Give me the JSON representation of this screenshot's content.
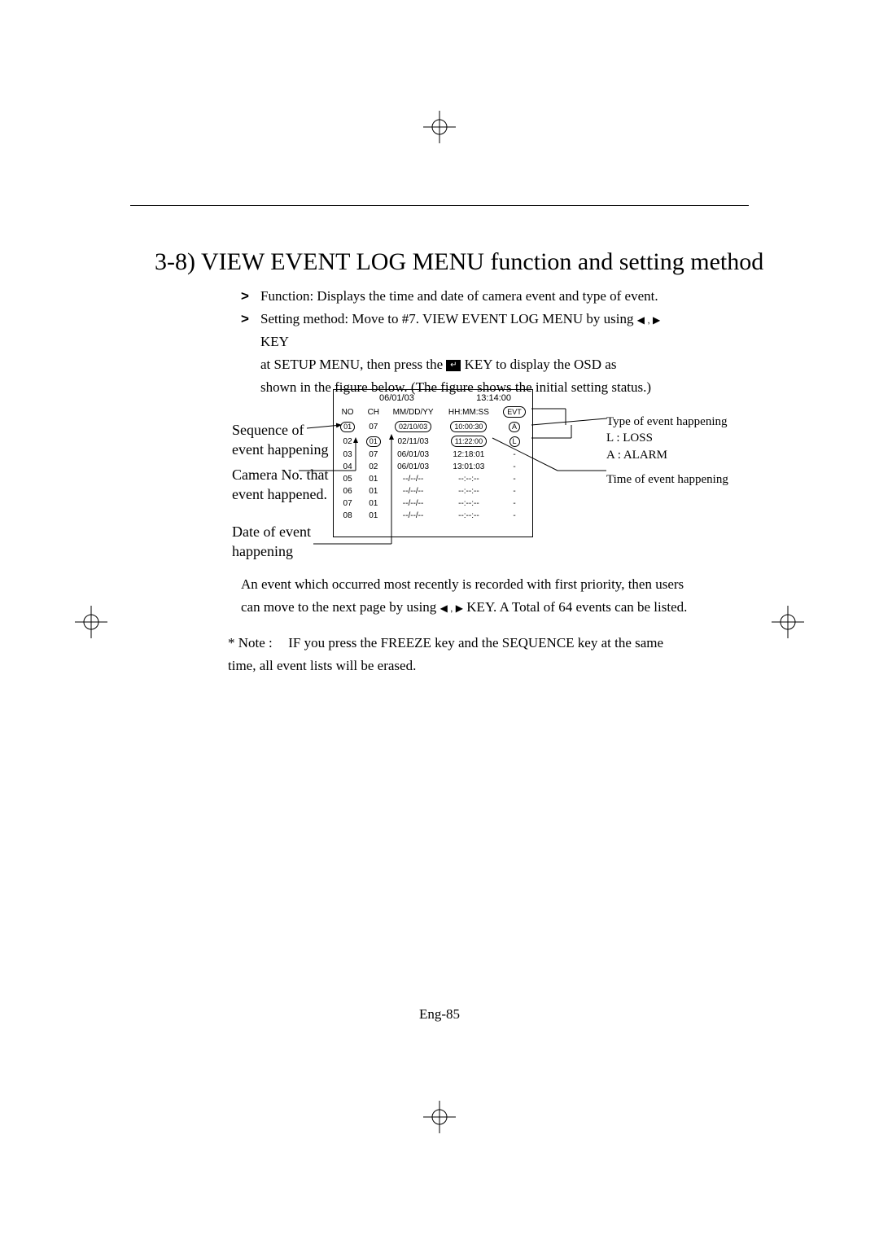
{
  "heading": "3-8)   VIEW EVENT LOG MENU function and setting method",
  "fn_label": "Function:",
  "fn_text": "Displays the time and date of camera event and type of event.",
  "sm_label": "Setting method:",
  "sm_l1a": "Move to #7. VIEW EVENT LOG MENU by using ",
  "sm_l1b": " KEY",
  "sm_l2a": "at SETUP MENU, then press the ",
  "sm_l2b": " KEY to display the OSD as",
  "sm_l3": "shown in the figure below. (The figure shows the initial setting status.)",
  "enter_glyph": "↵",
  "tri_lr": "◀ , ▶",
  "ann_seq": "Sequence of event happening",
  "ann_cam": "Camera No. that event happened.",
  "ann_date": "Date of event happening",
  "ann_type_t": "Type of event happening",
  "ann_type_l": "L : LOSS",
  "ann_type_a": "A : ALARM",
  "ann_time": "Time of event happening",
  "osd": {
    "date": "06/01/03",
    "time": "13:14:00",
    "cols": {
      "no": "NO",
      "ch": "CH",
      "dt": "MM/DD/YY",
      "tm": "HH:MM:SS",
      "ev": "EVT"
    },
    "rows": [
      {
        "no": "01",
        "ch": "07",
        "dt": "02/10/03",
        "tm": "10:00:30",
        "ev": "A",
        "no_c": true,
        "dt_c": true,
        "tm_c": true,
        "ev_c": true
      },
      {
        "no": "02",
        "ch": "01",
        "dt": "02/11/03",
        "tm": "11:22:00",
        "ev": "L",
        "ch_c": true,
        "tm_c": true,
        "ev_c": true
      },
      {
        "no": "03",
        "ch": "07",
        "dt": "06/01/03",
        "tm": "12:18:01",
        "ev": "-"
      },
      {
        "no": "04",
        "ch": "02",
        "dt": "06/01/03",
        "tm": "13:01:03",
        "ev": "-"
      },
      {
        "no": "05",
        "ch": "01",
        "dt": "--/--/--",
        "tm": "--:--:--",
        "ev": "-"
      },
      {
        "no": "06",
        "ch": "01",
        "dt": "--/--/--",
        "tm": "--:--:--",
        "ev": "-"
      },
      {
        "no": "07",
        "ch": "01",
        "dt": "--/--/--",
        "tm": "--:--:--",
        "ev": "-"
      },
      {
        "no": "08",
        "ch": "01",
        "dt": "--/--/--",
        "tm": "--:--:--",
        "ev": "-"
      }
    ]
  },
  "para_a": "An event which occurred most recently is recorded with first priority, then users can move to the next page by using ",
  "para_b": " KEY. A Total of 64 events can be listed.",
  "note_lbl": "* Note :",
  "note_txt": "IF you press the FREEZE key and the SEQUENCE key at the same time, all event lists will be erased.",
  "page": "Eng-85"
}
